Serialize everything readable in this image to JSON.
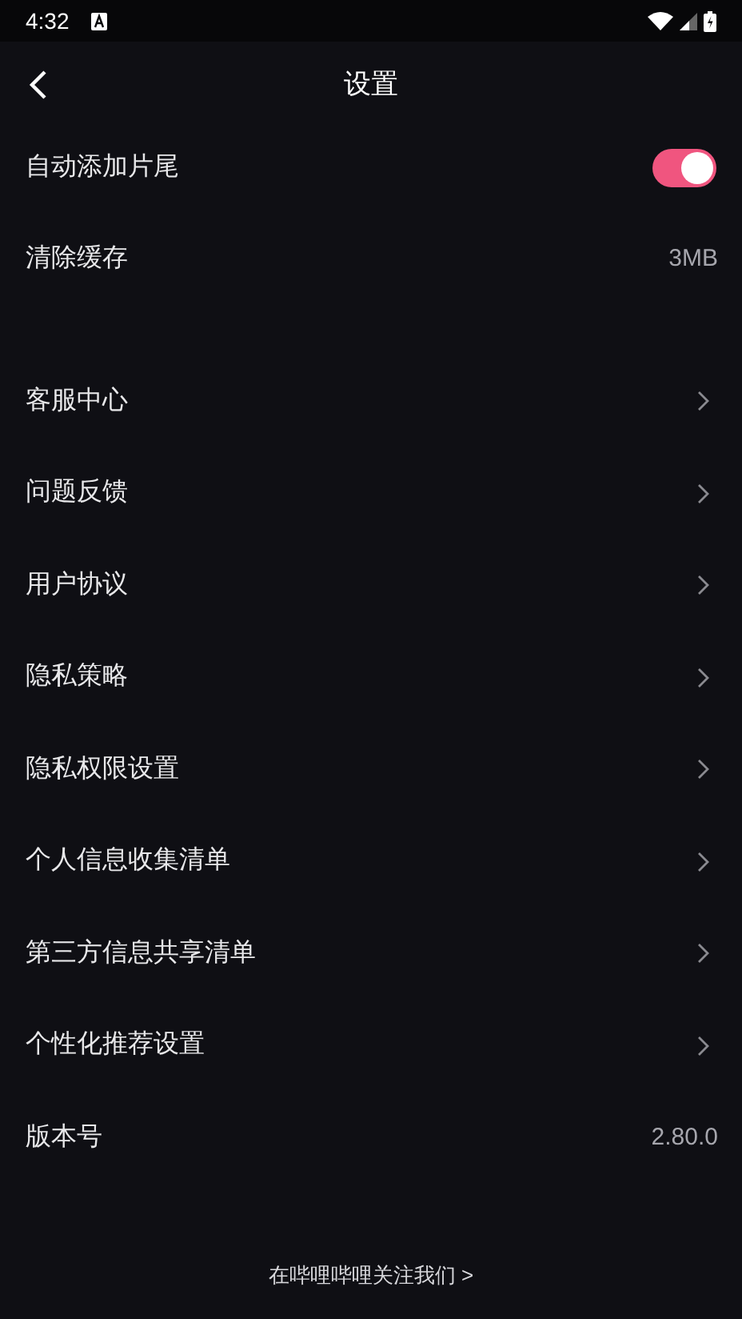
{
  "status_bar": {
    "time": "4:32"
  },
  "header": {
    "title": "设置"
  },
  "groups": [
    {
      "items": [
        {
          "kind": "toggle",
          "label": "自动添加片尾",
          "on": true
        },
        {
          "kind": "value",
          "label": "清除缓存",
          "value": "3MB"
        }
      ]
    },
    {
      "items": [
        {
          "kind": "link",
          "label": "客服中心"
        },
        {
          "kind": "link",
          "label": "问题反馈"
        },
        {
          "kind": "link",
          "label": "用户协议"
        },
        {
          "kind": "link",
          "label": "隐私策略"
        },
        {
          "kind": "link",
          "label": "隐私权限设置"
        },
        {
          "kind": "link",
          "label": "个人信息收集清单"
        },
        {
          "kind": "link",
          "label": "第三方信息共享清单"
        },
        {
          "kind": "link",
          "label": "个性化推荐设置"
        },
        {
          "kind": "value",
          "label": "版本号",
          "value": "2.80.0"
        }
      ]
    }
  ],
  "footer_link": "在哔哩哔哩关注我们 >"
}
